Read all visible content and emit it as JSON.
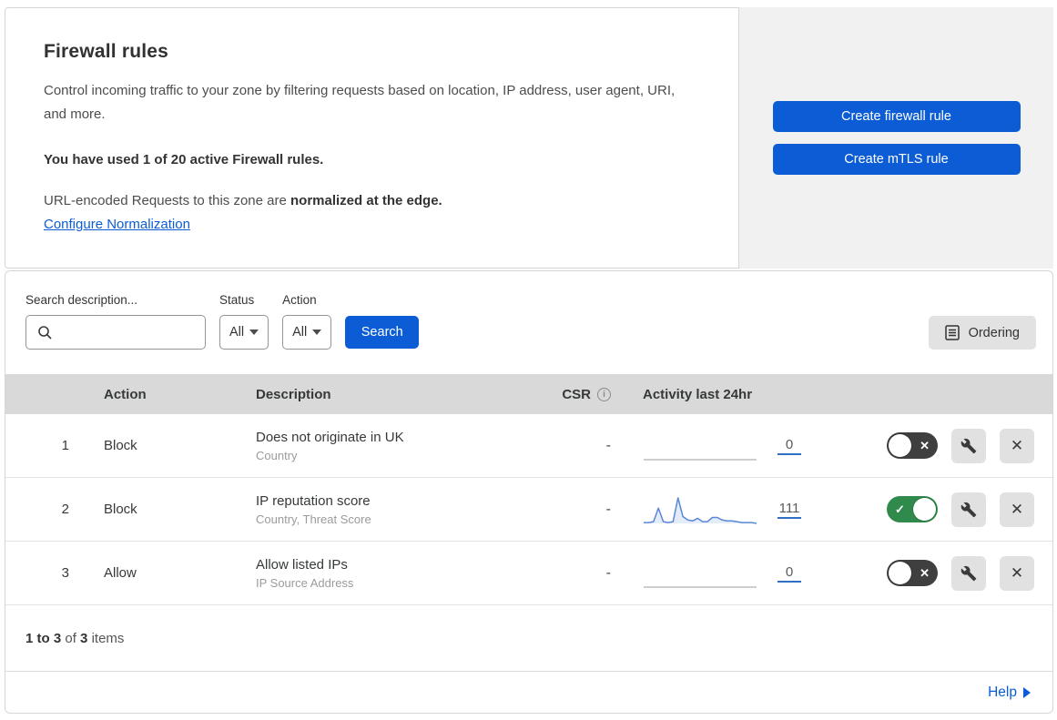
{
  "intro": {
    "title": "Firewall rules",
    "description": "Control incoming traffic to your zone by filtering requests based on location, IP address, user agent, URI, and more.",
    "usage": "You have used 1 of 20 active Firewall rules.",
    "normalization_prefix": "URL-encoded Requests to this zone are ",
    "normalization_bold": "normalized at the edge.",
    "normalization_link": "Configure Normalization",
    "create_firewall_button": "Create firewall rule",
    "create_mtls_button": "Create mTLS rule"
  },
  "filters": {
    "search_label": "Search description...",
    "search_value": "",
    "status_label": "Status",
    "status_value": "All",
    "action_label": "Action",
    "action_value": "All",
    "search_button": "Search",
    "ordering_button": "Ordering"
  },
  "table": {
    "columns": {
      "action": "Action",
      "description": "Description",
      "csr": "CSR",
      "activity": "Activity last 24hr"
    },
    "rows": [
      {
        "number": "1",
        "action": "Block",
        "description": "Does not originate in UK",
        "fields": "Country",
        "csr": "-",
        "count": "0",
        "enabled": false,
        "sparkline": [
          0,
          0,
          0,
          0,
          0,
          0,
          0,
          0,
          0,
          0,
          0,
          0,
          0,
          0,
          0,
          0,
          0,
          0,
          0,
          0,
          0,
          0,
          0,
          0
        ]
      },
      {
        "number": "2",
        "action": "Block",
        "description": "IP reputation score",
        "fields": "Country, Threat Score",
        "csr": "-",
        "count": "111",
        "enabled": true,
        "sparkline": [
          1,
          1,
          2,
          18,
          2,
          1,
          2,
          30,
          8,
          4,
          3,
          6,
          2,
          2,
          7,
          7,
          4,
          3,
          3,
          2,
          1,
          1,
          1,
          0
        ]
      },
      {
        "number": "3",
        "action": "Allow",
        "description": "Allow listed IPs",
        "fields": "IP Source Address",
        "csr": "-",
        "count": "0",
        "enabled": false,
        "sparkline": [
          0,
          0,
          0,
          0,
          0,
          0,
          0,
          0,
          0,
          0,
          0,
          0,
          0,
          0,
          0,
          0,
          0,
          0,
          0,
          0,
          0,
          0,
          0,
          0
        ]
      }
    ]
  },
  "chart_data": {
    "type": "line",
    "title": "Activity last 24hr sparkline (rule 2)",
    "x": [
      1,
      2,
      3,
      4,
      5,
      6,
      7,
      8,
      9,
      10,
      11,
      12,
      13,
      14,
      15,
      16,
      17,
      18,
      19,
      20,
      21,
      22,
      23,
      24
    ],
    "values": [
      1,
      1,
      2,
      18,
      2,
      1,
      2,
      30,
      8,
      4,
      3,
      6,
      2,
      2,
      7,
      7,
      4,
      3,
      3,
      2,
      1,
      1,
      1,
      0
    ],
    "total": 111,
    "xlabel": "",
    "ylabel": "",
    "legend": "none",
    "grid": false
  },
  "footer": {
    "range": "1 to 3",
    "of": "of",
    "total": "3",
    "items": "items",
    "help": "Help"
  },
  "colors": {
    "accent_blue": "#0b5cd5",
    "toggle_on_green": "#2f8a4c",
    "toggle_off_gray": "#3f3f3f",
    "table_header_bg": "#d9d9d9",
    "panel_bg": "#f1f1f1",
    "sparkline_blue": "#5b87d7"
  }
}
